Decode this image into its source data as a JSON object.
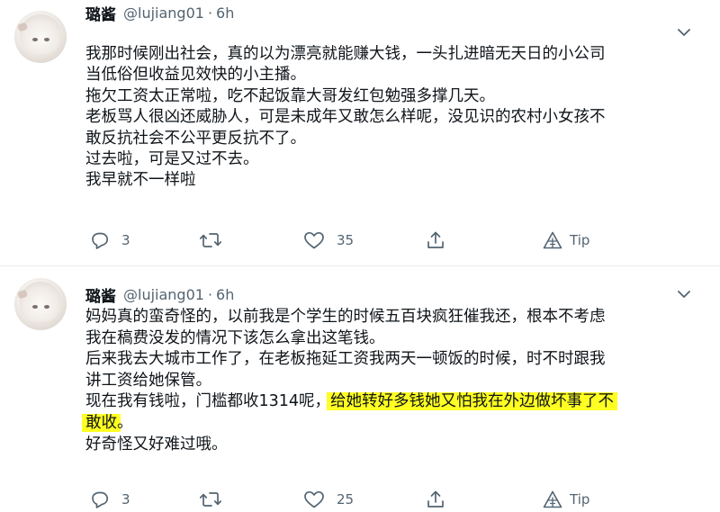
{
  "tweets": [
    {
      "author_name": "璐酱",
      "handle": "@lujiang01",
      "separator": "·",
      "time": "6h",
      "lines": [
        "我那时候刚出社会，真的以为漂亮就能赚大钱，一头扎进暗无天日的小公司",
        "当低俗但收益见效快的小主播。",
        "拖欠工资太正常啦，吃不起饭靠大哥发红包勉强多撑几天。",
        "老板骂人很凶还威胁人，可是未成年又敢怎么样呢，没见识的农村小女孩不",
        "敢反抗社会不公平更反抗不了。",
        "过去啦，可是又过不去。",
        "我早就不一样啦"
      ],
      "actions": {
        "reply_count": "3",
        "retweet_count": "",
        "like_count": "35",
        "tip_label": "Tip"
      }
    },
    {
      "author_name": "璐酱",
      "handle": "@lujiang01",
      "separator": "·",
      "time": "6h",
      "lines": [
        "妈妈真的蛮奇怪的，以前我是个学生的时候五百块疯狂催我还，根本不考虑",
        "我在稿费没发的情况下该怎么拿出这笔钱。",
        "后来我去大城市工作了，在老板拖延工资我两天一顿饭的时候，时不时跟我",
        "讲工资给她保管。"
      ],
      "line5_plain": "现在我有钱啦，门槛都收1314呢，",
      "line5_highlight": "给她转好多钱她又怕我在外边做坏事了不",
      "line6_highlight": "敢收",
      "line6_plain": "。",
      "line7": "好奇怪又好难过哦。",
      "actions": {
        "reply_count": "3",
        "retweet_count": "",
        "like_count": "25",
        "tip_label": "Tip"
      }
    }
  ],
  "colors": {
    "text": "#0f1419",
    "secondary": "#536471",
    "divider": "#e6ecf0",
    "highlight": "#ffff22"
  },
  "icons": [
    "avatar",
    "more-icon",
    "reply-icon",
    "retweet-icon",
    "like-icon",
    "share-icon",
    "tip-icon"
  ]
}
